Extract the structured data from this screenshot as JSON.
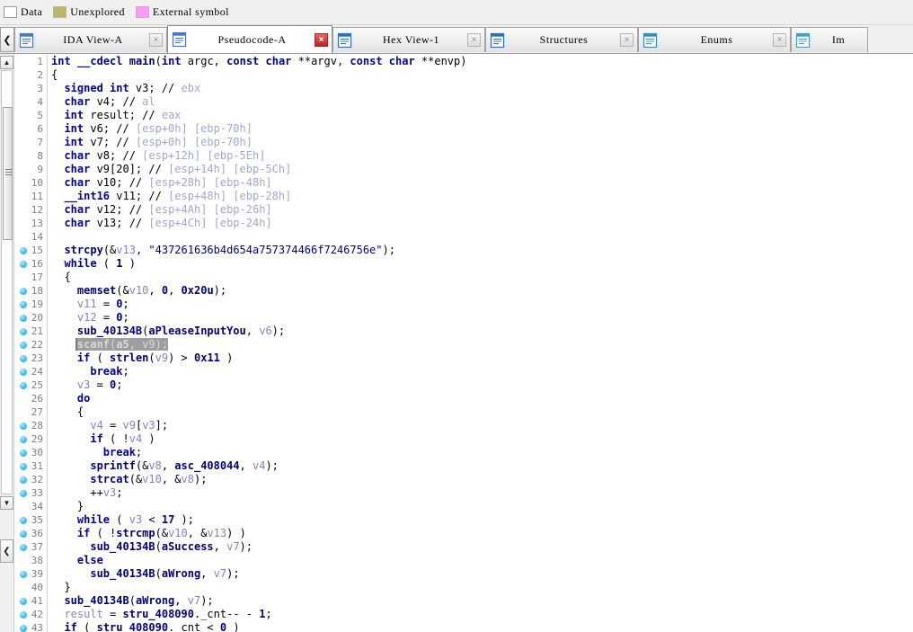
{
  "legend": {
    "items": [
      {
        "label": "Data",
        "color": "#ffffff",
        "swatch": true
      },
      {
        "label": "Unexplored",
        "color": "#bdb76b",
        "swatch": true
      },
      {
        "label": "External symbol",
        "color": "#ff99ff",
        "swatch": true
      }
    ]
  },
  "tabbar": {
    "scroll_left_label": "❮",
    "tabs": [
      {
        "label": "IDA View-A",
        "icon": "document-view-icon",
        "close_label": "×",
        "active": false
      },
      {
        "label": "Pseudocode-A",
        "icon": "pseudocode-view-icon",
        "close_label": "×",
        "active": true
      },
      {
        "label": "Hex View-1",
        "icon": "hex-view-icon",
        "close_label": "×",
        "active": false
      },
      {
        "label": "Structures",
        "icon": "structures-icon",
        "close_label": "×",
        "active": false
      },
      {
        "label": "Enums",
        "icon": "enums-icon",
        "close_label": "×",
        "active": false
      },
      {
        "label": "Im",
        "icon": "imports-icon",
        "close_label": "",
        "active": false
      }
    ]
  },
  "left_dock": {
    "scroll_up_label": "▲",
    "scroll_down_label": "▼",
    "collapse_label": "❮"
  },
  "editor": {
    "selected_line": 22,
    "lines": [
      {
        "n": 1,
        "bp": false,
        "tokens": [
          [
            "t-kw",
            "int"
          ],
          [
            "t-plain",
            " "
          ],
          [
            "t-kw",
            "__cdecl"
          ],
          [
            "t-plain",
            " "
          ],
          [
            "t-fn",
            "main"
          ],
          [
            "t-plain",
            "("
          ],
          [
            "t-kw",
            "int"
          ],
          [
            "t-plain",
            " argc, "
          ],
          [
            "t-kw",
            "const char"
          ],
          [
            "t-plain",
            " **argv, "
          ],
          [
            "t-kw",
            "const char"
          ],
          [
            "t-plain",
            " **envp)"
          ]
        ]
      },
      {
        "n": 2,
        "bp": false,
        "tokens": [
          [
            "t-plain",
            "{"
          ]
        ]
      },
      {
        "n": 3,
        "bp": false,
        "tokens": [
          [
            "t-plain",
            "  "
          ],
          [
            "t-kw",
            "signed int"
          ],
          [
            "t-plain",
            " v3; "
          ],
          [
            "t-plain",
            "// "
          ],
          [
            "t-cmt",
            "ebx"
          ]
        ]
      },
      {
        "n": 4,
        "bp": false,
        "tokens": [
          [
            "t-plain",
            "  "
          ],
          [
            "t-kw",
            "char"
          ],
          [
            "t-plain",
            " v4; // "
          ],
          [
            "t-cmt",
            "al"
          ]
        ]
      },
      {
        "n": 5,
        "bp": false,
        "tokens": [
          [
            "t-plain",
            "  "
          ],
          [
            "t-kw",
            "int"
          ],
          [
            "t-plain",
            " result; // "
          ],
          [
            "t-cmt",
            "eax"
          ]
        ]
      },
      {
        "n": 6,
        "bp": false,
        "tokens": [
          [
            "t-plain",
            "  "
          ],
          [
            "t-kw",
            "int"
          ],
          [
            "t-plain",
            " v6; // "
          ],
          [
            "t-cmt",
            "[esp+0h] [ebp-70h]"
          ]
        ]
      },
      {
        "n": 7,
        "bp": false,
        "tokens": [
          [
            "t-plain",
            "  "
          ],
          [
            "t-kw",
            "int"
          ],
          [
            "t-plain",
            " v7; // "
          ],
          [
            "t-cmt",
            "[esp+0h] [ebp-70h]"
          ]
        ]
      },
      {
        "n": 8,
        "bp": false,
        "tokens": [
          [
            "t-plain",
            "  "
          ],
          [
            "t-kw",
            "char"
          ],
          [
            "t-plain",
            " v8; // "
          ],
          [
            "t-cmt",
            "[esp+12h] [ebp-5Eh]"
          ]
        ]
      },
      {
        "n": 9,
        "bp": false,
        "tokens": [
          [
            "t-plain",
            "  "
          ],
          [
            "t-kw",
            "char"
          ],
          [
            "t-plain",
            " v9[20]; // "
          ],
          [
            "t-cmt",
            "[esp+14h] [ebp-5Ch]"
          ]
        ]
      },
      {
        "n": 10,
        "bp": false,
        "tokens": [
          [
            "t-plain",
            "  "
          ],
          [
            "t-kw",
            "char"
          ],
          [
            "t-plain",
            " v10; // "
          ],
          [
            "t-cmt",
            "[esp+28h] [ebp-48h]"
          ]
        ]
      },
      {
        "n": 11,
        "bp": false,
        "tokens": [
          [
            "t-plain",
            "  "
          ],
          [
            "t-kw",
            "__int16"
          ],
          [
            "t-plain",
            " v11; // "
          ],
          [
            "t-cmt",
            "[esp+48h] [ebp-28h]"
          ]
        ]
      },
      {
        "n": 12,
        "bp": false,
        "tokens": [
          [
            "t-plain",
            "  "
          ],
          [
            "t-kw",
            "char"
          ],
          [
            "t-plain",
            " v12; // "
          ],
          [
            "t-cmt",
            "[esp+4Ah] [ebp-26h]"
          ]
        ]
      },
      {
        "n": 13,
        "bp": false,
        "tokens": [
          [
            "t-plain",
            "  "
          ],
          [
            "t-kw",
            "char"
          ],
          [
            "t-plain",
            " v13; // "
          ],
          [
            "t-cmt",
            "[esp+4Ch] [ebp-24h]"
          ]
        ]
      },
      {
        "n": 14,
        "bp": false,
        "tokens": [
          [
            "t-plain",
            ""
          ]
        ]
      },
      {
        "n": 15,
        "bp": true,
        "tokens": [
          [
            "t-plain",
            "  "
          ],
          [
            "t-fn",
            "strcpy"
          ],
          [
            "t-plain",
            "(&"
          ],
          [
            "t-var",
            "v13"
          ],
          [
            "t-plain",
            ", "
          ],
          [
            "t-str",
            "\"437261636b4d654a757374466f7246756e\""
          ],
          [
            "t-plain",
            ");"
          ]
        ]
      },
      {
        "n": 16,
        "bp": true,
        "tokens": [
          [
            "t-plain",
            "  "
          ],
          [
            "t-kw",
            "while"
          ],
          [
            "t-plain",
            " ( "
          ],
          [
            "t-num",
            "1"
          ],
          [
            "t-plain",
            " )"
          ]
        ]
      },
      {
        "n": 17,
        "bp": false,
        "tokens": [
          [
            "t-plain",
            "  {"
          ]
        ]
      },
      {
        "n": 18,
        "bp": true,
        "tokens": [
          [
            "t-plain",
            "    "
          ],
          [
            "t-fn",
            "memset"
          ],
          [
            "t-plain",
            "(&"
          ],
          [
            "t-var",
            "v10"
          ],
          [
            "t-plain",
            ", "
          ],
          [
            "t-num",
            "0"
          ],
          [
            "t-plain",
            ", "
          ],
          [
            "t-num",
            "0x20u"
          ],
          [
            "t-plain",
            ");"
          ]
        ]
      },
      {
        "n": 19,
        "bp": true,
        "tokens": [
          [
            "t-plain",
            "    "
          ],
          [
            "t-var",
            "v11"
          ],
          [
            "t-plain",
            " = "
          ],
          [
            "t-num",
            "0"
          ],
          [
            "t-plain",
            ";"
          ]
        ]
      },
      {
        "n": 20,
        "bp": true,
        "tokens": [
          [
            "t-plain",
            "    "
          ],
          [
            "t-var",
            "v12"
          ],
          [
            "t-plain",
            " = "
          ],
          [
            "t-num",
            "0"
          ],
          [
            "t-plain",
            ";"
          ]
        ]
      },
      {
        "n": 21,
        "bp": true,
        "tokens": [
          [
            "t-plain",
            "    "
          ],
          [
            "t-fn",
            "sub_40134B"
          ],
          [
            "t-plain",
            "("
          ],
          [
            "t-fn",
            "aPleaseInputYou"
          ],
          [
            "t-plain",
            ", "
          ],
          [
            "t-var",
            "v6"
          ],
          [
            "t-plain",
            ");"
          ]
        ]
      },
      {
        "n": 22,
        "bp": true,
        "selected": true,
        "tokens": [
          [
            "t-plain",
            "    "
          ],
          [
            "t-fn",
            "scanf"
          ],
          [
            "t-plain",
            "("
          ],
          [
            "t-fn",
            "a5"
          ],
          [
            "t-plain",
            ", "
          ],
          [
            "t-var",
            "v9"
          ],
          [
            "t-plain",
            ");"
          ]
        ]
      },
      {
        "n": 23,
        "bp": true,
        "tokens": [
          [
            "t-plain",
            "    "
          ],
          [
            "t-kw",
            "if"
          ],
          [
            "t-plain",
            " ( "
          ],
          [
            "t-fn",
            "strlen"
          ],
          [
            "t-plain",
            "("
          ],
          [
            "t-var",
            "v9"
          ],
          [
            "t-plain",
            ") > "
          ],
          [
            "t-num",
            "0x11"
          ],
          [
            "t-plain",
            " )"
          ]
        ]
      },
      {
        "n": 24,
        "bp": true,
        "tokens": [
          [
            "t-plain",
            "      "
          ],
          [
            "t-kw",
            "break"
          ],
          [
            "t-plain",
            ";"
          ]
        ]
      },
      {
        "n": 25,
        "bp": true,
        "tokens": [
          [
            "t-plain",
            "    "
          ],
          [
            "t-var",
            "v3"
          ],
          [
            "t-plain",
            " = "
          ],
          [
            "t-num",
            "0"
          ],
          [
            "t-plain",
            ";"
          ]
        ]
      },
      {
        "n": 26,
        "bp": false,
        "tokens": [
          [
            "t-plain",
            "    "
          ],
          [
            "t-kw",
            "do"
          ]
        ]
      },
      {
        "n": 27,
        "bp": false,
        "tokens": [
          [
            "t-plain",
            "    {"
          ]
        ]
      },
      {
        "n": 28,
        "bp": true,
        "tokens": [
          [
            "t-plain",
            "      "
          ],
          [
            "t-var",
            "v4"
          ],
          [
            "t-plain",
            " = "
          ],
          [
            "t-var",
            "v9"
          ],
          [
            "t-plain",
            "["
          ],
          [
            "t-var",
            "v3"
          ],
          [
            "t-plain",
            "];"
          ]
        ]
      },
      {
        "n": 29,
        "bp": true,
        "tokens": [
          [
            "t-plain",
            "      "
          ],
          [
            "t-kw",
            "if"
          ],
          [
            "t-plain",
            " ( !"
          ],
          [
            "t-var",
            "v4"
          ],
          [
            "t-plain",
            " )"
          ]
        ]
      },
      {
        "n": 30,
        "bp": true,
        "tokens": [
          [
            "t-plain",
            "        "
          ],
          [
            "t-kw",
            "break"
          ],
          [
            "t-plain",
            ";"
          ]
        ]
      },
      {
        "n": 31,
        "bp": true,
        "tokens": [
          [
            "t-plain",
            "      "
          ],
          [
            "t-fn",
            "sprintf"
          ],
          [
            "t-plain",
            "(&"
          ],
          [
            "t-var",
            "v8"
          ],
          [
            "t-plain",
            ", "
          ],
          [
            "t-fn",
            "asc_408044"
          ],
          [
            "t-plain",
            ", "
          ],
          [
            "t-var",
            "v4"
          ],
          [
            "t-plain",
            ");"
          ]
        ]
      },
      {
        "n": 32,
        "bp": true,
        "tokens": [
          [
            "t-plain",
            "      "
          ],
          [
            "t-fn",
            "strcat"
          ],
          [
            "t-plain",
            "(&"
          ],
          [
            "t-var",
            "v10"
          ],
          [
            "t-plain",
            ", &"
          ],
          [
            "t-var",
            "v8"
          ],
          [
            "t-plain",
            ");"
          ]
        ]
      },
      {
        "n": 33,
        "bp": true,
        "tokens": [
          [
            "t-plain",
            "      ++"
          ],
          [
            "t-var",
            "v3"
          ],
          [
            "t-plain",
            ";"
          ]
        ]
      },
      {
        "n": 34,
        "bp": false,
        "tokens": [
          [
            "t-plain",
            "    }"
          ]
        ]
      },
      {
        "n": 35,
        "bp": true,
        "tokens": [
          [
            "t-plain",
            "    "
          ],
          [
            "t-kw",
            "while"
          ],
          [
            "t-plain",
            " ( "
          ],
          [
            "t-var",
            "v3"
          ],
          [
            "t-plain",
            " < "
          ],
          [
            "t-num",
            "17"
          ],
          [
            "t-plain",
            " );"
          ]
        ]
      },
      {
        "n": 36,
        "bp": true,
        "tokens": [
          [
            "t-plain",
            "    "
          ],
          [
            "t-kw",
            "if"
          ],
          [
            "t-plain",
            " ( !"
          ],
          [
            "t-fn",
            "strcmp"
          ],
          [
            "t-plain",
            "(&"
          ],
          [
            "t-var",
            "v10"
          ],
          [
            "t-plain",
            ", &"
          ],
          [
            "t-var",
            "v13"
          ],
          [
            "t-plain",
            ") )"
          ]
        ]
      },
      {
        "n": 37,
        "bp": true,
        "tokens": [
          [
            "t-plain",
            "      "
          ],
          [
            "t-fn",
            "sub_40134B"
          ],
          [
            "t-plain",
            "("
          ],
          [
            "t-fn",
            "aSuccess"
          ],
          [
            "t-plain",
            ", "
          ],
          [
            "t-var",
            "v7"
          ],
          [
            "t-plain",
            ");"
          ]
        ]
      },
      {
        "n": 38,
        "bp": false,
        "tokens": [
          [
            "t-plain",
            "    "
          ],
          [
            "t-kw",
            "else"
          ]
        ]
      },
      {
        "n": 39,
        "bp": true,
        "tokens": [
          [
            "t-plain",
            "      "
          ],
          [
            "t-fn",
            "sub_40134B"
          ],
          [
            "t-plain",
            "("
          ],
          [
            "t-fn",
            "aWrong"
          ],
          [
            "t-plain",
            ", "
          ],
          [
            "t-var",
            "v7"
          ],
          [
            "t-plain",
            ");"
          ]
        ]
      },
      {
        "n": 40,
        "bp": false,
        "tokens": [
          [
            "t-plain",
            "  }"
          ]
        ]
      },
      {
        "n": 41,
        "bp": true,
        "tokens": [
          [
            "t-plain",
            "  "
          ],
          [
            "t-fn",
            "sub_40134B"
          ],
          [
            "t-plain",
            "("
          ],
          [
            "t-fn",
            "aWrong"
          ],
          [
            "t-plain",
            ", "
          ],
          [
            "t-var",
            "v7"
          ],
          [
            "t-plain",
            ");"
          ]
        ]
      },
      {
        "n": 42,
        "bp": true,
        "tokens": [
          [
            "t-plain",
            "  "
          ],
          [
            "t-var",
            "result"
          ],
          [
            "t-plain",
            " = "
          ],
          [
            "t-fn",
            "stru_408090"
          ],
          [
            "t-plain",
            "._cnt-- - "
          ],
          [
            "t-num",
            "1"
          ],
          [
            "t-plain",
            ";"
          ]
        ]
      },
      {
        "n": 43,
        "bp": true,
        "tokens": [
          [
            "t-plain",
            "  "
          ],
          [
            "t-kw",
            "if"
          ],
          [
            "t-plain",
            " ( "
          ],
          [
            "t-fn",
            "stru_408090"
          ],
          [
            "t-plain",
            "._cnt < "
          ],
          [
            "t-num",
            "0"
          ],
          [
            "t-plain",
            " )"
          ]
        ]
      }
    ]
  }
}
